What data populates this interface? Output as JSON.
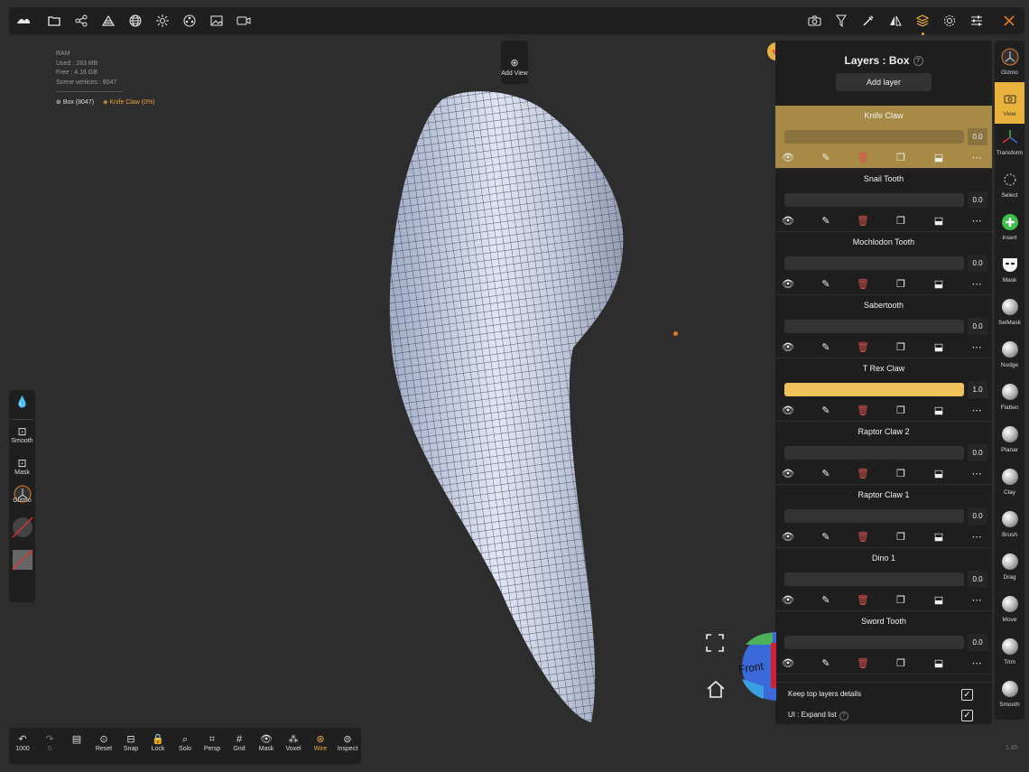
{
  "top_toolbar": {
    "left_icons": [
      "logo-icon",
      "folder-icon",
      "share-icon",
      "scene-icon",
      "grid-sphere-icon",
      "light-icon",
      "material-icon",
      "image-icon",
      "video-icon"
    ],
    "right_icons": [
      "camera-icon",
      "filter-icon",
      "eyedropper-icon",
      "symmetry-icon",
      "layers-icon",
      "settings-icon",
      "sliders-icon",
      "tools-icon"
    ]
  },
  "stats": {
    "ram_label": "RAM",
    "used": "Used : 283 MB",
    "free": "Free : 4.16 GB",
    "scene_vertices": "Scene vertices : 8047"
  },
  "scene": {
    "object": "Box (8047)",
    "active_layer": "Knife Claw (0%)"
  },
  "add_view": {
    "label": "Add View"
  },
  "left_panel": {
    "items": [
      {
        "label": "Smooth"
      },
      {
        "label": "Mask"
      },
      {
        "label": "Gizmo"
      }
    ]
  },
  "layers": {
    "title": "Layers : Box",
    "add_label": "Add layer",
    "items": [
      {
        "name": "Knife Claw",
        "value": "0.0",
        "fill": 0.0,
        "active": true
      },
      {
        "name": "Snail Tooth",
        "value": "0.0",
        "fill": 0.0
      },
      {
        "name": "Mochlodon Tooth",
        "value": "0.0",
        "fill": 0.0
      },
      {
        "name": "Sabertooth",
        "value": "0.0",
        "fill": 0.0
      },
      {
        "name": "T Rex Claw",
        "value": "1.0",
        "fill": 1.0
      },
      {
        "name": "Raptor Claw 2",
        "value": "0.0",
        "fill": 0.0
      },
      {
        "name": "Raptor Claw 1",
        "value": "0.0",
        "fill": 0.0
      },
      {
        "name": "Dino 1",
        "value": "0.0",
        "fill": 0.0
      },
      {
        "name": "Sword Tooth",
        "value": "0.0",
        "fill": 0.0
      }
    ],
    "options": {
      "keep_top": "Keep top layers details",
      "expand": "UI : Expand list"
    }
  },
  "right_tools": [
    {
      "label": "Gizmo"
    },
    {
      "label": "View",
      "active": true
    },
    {
      "label": "Transform"
    },
    {
      "label": "Select"
    },
    {
      "label": "Insert"
    },
    {
      "label": "Mask"
    },
    {
      "label": "SelMask"
    },
    {
      "label": "Nudge"
    },
    {
      "label": "Flatten"
    },
    {
      "label": "Planar"
    },
    {
      "label": "Clay"
    },
    {
      "label": "Brush"
    },
    {
      "label": "Drag"
    },
    {
      "label": "Move"
    },
    {
      "label": "Trim"
    },
    {
      "label": "Smooth"
    }
  ],
  "bottom_toolbar": [
    {
      "label": "1000",
      "icon": "undo-icon"
    },
    {
      "label": "0",
      "icon": "redo-icon"
    },
    {
      "label": "",
      "icon": "history-icon"
    },
    {
      "label": "Reset",
      "icon": "reset-camera-icon"
    },
    {
      "label": "Snap",
      "icon": "snap-icon"
    },
    {
      "label": "Lock",
      "icon": "lock-icon"
    },
    {
      "label": "Solo",
      "icon": "solo-icon"
    },
    {
      "label": "Persp",
      "icon": "perspective-icon"
    },
    {
      "label": "Grid",
      "icon": "grid-icon"
    },
    {
      "label": "Mask",
      "icon": "eye-icon"
    },
    {
      "label": "Voxel",
      "icon": "voxel-icon"
    },
    {
      "label": "Wire",
      "icon": "wire-icon",
      "active": true
    },
    {
      "label": "Inspect",
      "icon": "inspect-icon"
    }
  ],
  "nav_cube_label": "Front",
  "version": "1.85"
}
